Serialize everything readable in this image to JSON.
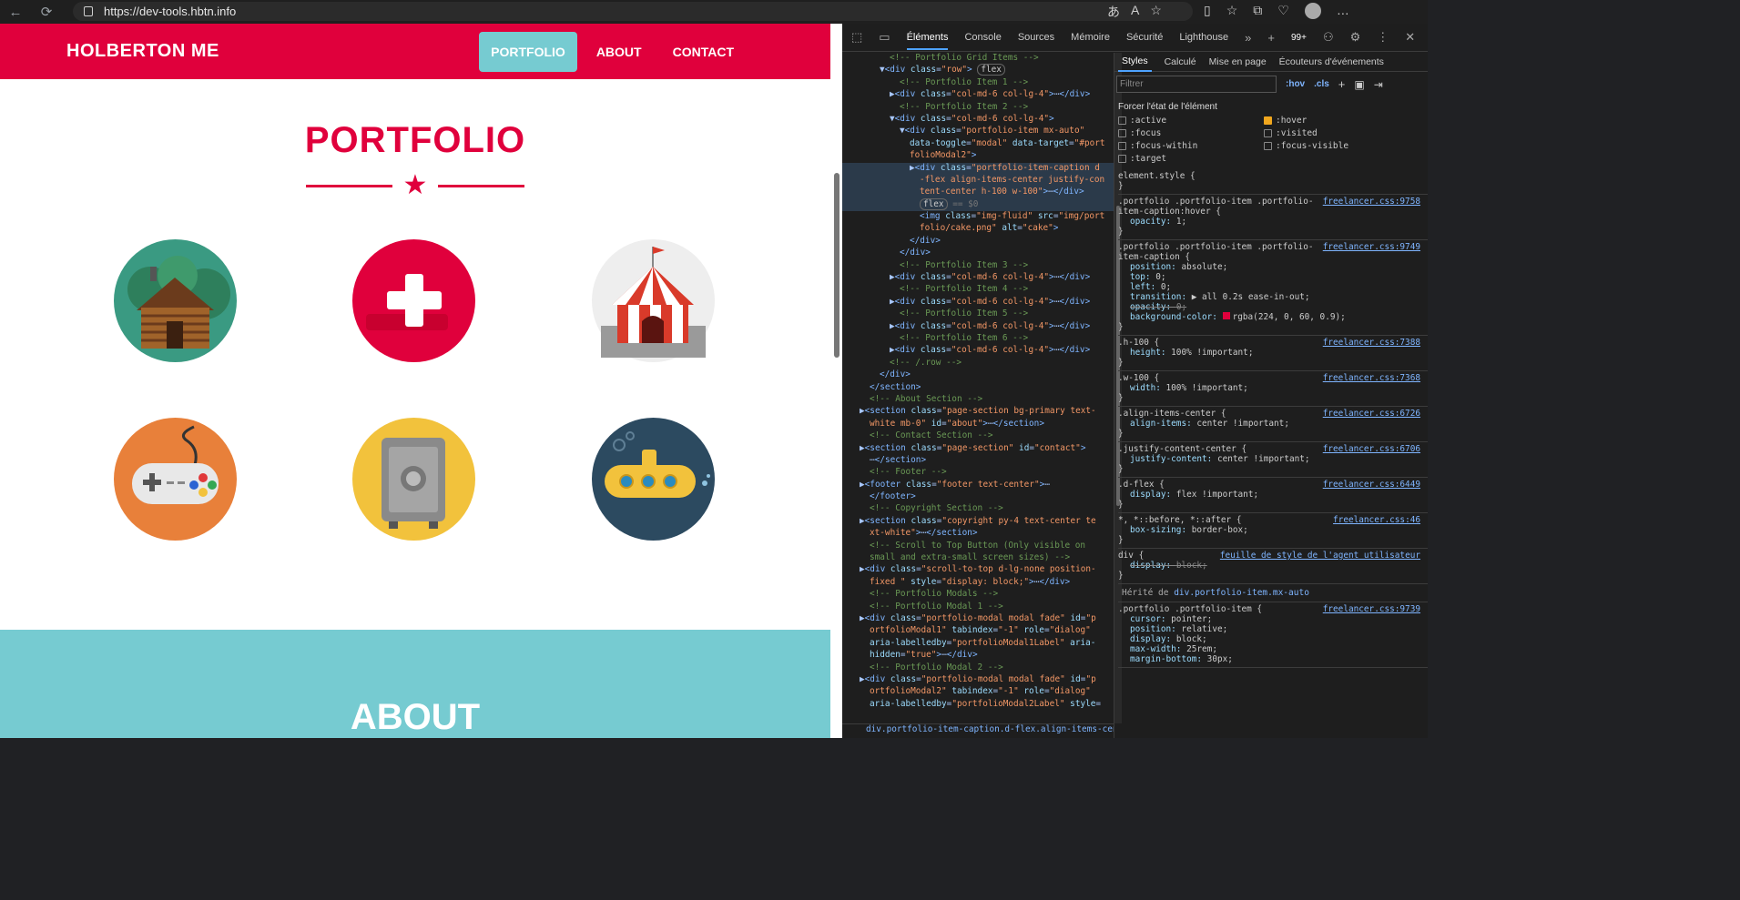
{
  "browser": {
    "url": "https://dev-tools.hbtn.info",
    "nav_back": "←",
    "nav_reload": "⟳",
    "url_icons": [
      "あ",
      "A",
      "☆"
    ],
    "toolbar_icons": [
      "▯",
      "☆",
      "⧉",
      "♡",
      "●",
      "…"
    ]
  },
  "site": {
    "brand": "HOLBERTON ME",
    "nav": [
      "PORTFOLIO",
      "ABOUT",
      "CONTACT"
    ],
    "portfolio_title": "PORTFOLIO",
    "about_title": "ABOUT",
    "colors": {
      "primary": "#e0003c",
      "secondary": "#76cbd1"
    },
    "tiles": [
      {
        "name": "cabin",
        "bg": "#bd4a67",
        "circle": "#3a9a82"
      },
      {
        "name": "cake",
        "bg": "#d71a4f",
        "circle": "#e0003c"
      },
      {
        "name": "circus",
        "bg": "#141414",
        "circle": "#eeeeee"
      },
      {
        "name": "game",
        "bg": "#1e7ec2",
        "circle": "#e8803a"
      },
      {
        "name": "safe",
        "bg": "#1034c0",
        "circle": "#f2c23c"
      },
      {
        "name": "submarine",
        "bg": "#d3b4a4",
        "circle": "#2c4a60"
      }
    ]
  },
  "devtools": {
    "tabs": [
      "Éléments",
      "Console",
      "Sources",
      "Mémoire",
      "Sécurité",
      "Lighthouse"
    ],
    "badge": "99+",
    "dom_lines": [
      {
        "indent": 4,
        "html": "<span class='cm'>&lt;!-- Portfolio Grid Items --&gt;</span>"
      },
      {
        "indent": 3,
        "html": "▼<span class='tg'>&lt;div</span> <span class='at'>class</span>=<span class='av'>\"row\"</span><span class='tg'>&gt;</span> <span style='border:1px solid #666;border-radius:6px;padding:0 3px;color:#ccc'>flex</span>"
      },
      {
        "indent": 5,
        "html": "<span class='cm'>&lt;!-- Portfolio Item 1 --&gt;</span>"
      },
      {
        "indent": 4,
        "html": "▶<span class='tg'>&lt;div</span> <span class='at'>class</span>=<span class='av'>\"col-md-6 col-lg-4\"</span><span class='tg'>&gt;</span>⋯<span class='tg'>&lt;/div&gt;</span>"
      },
      {
        "indent": 5,
        "html": "<span class='cm'>&lt;!-- Portfolio Item 2 --&gt;</span>"
      },
      {
        "indent": 4,
        "html": "▼<span class='tg'>&lt;div</span> <span class='at'>class</span>=<span class='av'>\"col-md-6 col-lg-4\"</span><span class='tg'>&gt;</span>"
      },
      {
        "indent": 5,
        "html": "▼<span class='tg'>&lt;div</span> <span class='at'>class</span>=<span class='av'>\"portfolio-item mx-auto\"</span>"
      },
      {
        "indent": 6,
        "html": "<span class='at'>data-toggle</span>=<span class='av'>\"modal\"</span> <span class='at'>data-target</span>=<span class='av'>\"#port</span>"
      },
      {
        "indent": 6,
        "html": "<span class='av'>folioModal2\"</span><span class='tg'>&gt;</span>"
      },
      {
        "indent": 6,
        "html": "▶<span class='tg'>&lt;div</span> <span class='at'>class</span>=<span class='av'>\"portfolio-item-caption d</span>",
        "sel": true
      },
      {
        "indent": 7,
        "html": "<span class='av'>-flex align-items-center justify-con</span>",
        "sel": true
      },
      {
        "indent": 7,
        "html": "<span class='av'>tent-center h-100 w-100\"</span><span class='tg'>&gt;</span>⋯<span class='tg'>&lt;/div&gt;</span>",
        "sel": true
      },
      {
        "indent": 7,
        "html": "<span style='border:1px solid #666;border-radius:6px;padding:0 3px;color:#ccc'>flex</span> <span style='color:#777'>== $0</span>",
        "sel": true
      },
      {
        "indent": 7,
        "html": "<span class='tg'>&lt;img</span> <span class='at'>class</span>=<span class='av'>\"img-fluid\"</span> <span class='at'>src</span>=<span class='av'>\"img/port</span>"
      },
      {
        "indent": 7,
        "html": "<span class='av'>folio/cake.png\"</span> <span class='at'>alt</span>=<span class='av'>\"cake\"</span><span class='tg'>&gt;</span>"
      },
      {
        "indent": 6,
        "html": "<span class='tg'>&lt;/div&gt;</span>"
      },
      {
        "indent": 5,
        "html": "<span class='tg'>&lt;/div&gt;</span>"
      },
      {
        "indent": 5,
        "html": "<span class='cm'>&lt;!-- Portfolio Item 3 --&gt;</span>"
      },
      {
        "indent": 4,
        "html": "▶<span class='tg'>&lt;div</span> <span class='at'>class</span>=<span class='av'>\"col-md-6 col-lg-4\"</span><span class='tg'>&gt;</span>⋯<span class='tg'>&lt;/div&gt;</span>"
      },
      {
        "indent": 5,
        "html": "<span class='cm'>&lt;!-- Portfolio Item 4 --&gt;</span>"
      },
      {
        "indent": 4,
        "html": "▶<span class='tg'>&lt;div</span> <span class='at'>class</span>=<span class='av'>\"col-md-6 col-lg-4\"</span><span class='tg'>&gt;</span>⋯<span class='tg'>&lt;/div&gt;</span>"
      },
      {
        "indent": 5,
        "html": "<span class='cm'>&lt;!-- Portfolio Item 5 --&gt;</span>"
      },
      {
        "indent": 4,
        "html": "▶<span class='tg'>&lt;div</span> <span class='at'>class</span>=<span class='av'>\"col-md-6 col-lg-4\"</span><span class='tg'>&gt;</span>⋯<span class='tg'>&lt;/div&gt;</span>"
      },
      {
        "indent": 5,
        "html": "<span class='cm'>&lt;!-- Portfolio Item 6 --&gt;</span>"
      },
      {
        "indent": 4,
        "html": "▶<span class='tg'>&lt;div</span> <span class='at'>class</span>=<span class='av'>\"col-md-6 col-lg-4\"</span><span class='tg'>&gt;</span>⋯<span class='tg'>&lt;/div&gt;</span>"
      },
      {
        "indent": 4,
        "html": "<span class='cm'>&lt;!-- /.row --&gt;</span>"
      },
      {
        "indent": 3,
        "html": "<span class='tg'>&lt;/div&gt;</span>"
      },
      {
        "indent": 2,
        "html": "<span class='tg'>&lt;/section&gt;</span>"
      },
      {
        "indent": 2,
        "html": "<span class='cm'>&lt;!-- About Section --&gt;</span>"
      },
      {
        "indent": 1,
        "html": "▶<span class='tg'>&lt;section</span> <span class='at'>class</span>=<span class='av'>\"page-section bg-primary text-</span>"
      },
      {
        "indent": 2,
        "html": "<span class='av'>white mb-0\"</span> <span class='at'>id</span>=<span class='av'>\"about\"</span><span class='tg'>&gt;</span>⋯<span class='tg'>&lt;/section&gt;</span>"
      },
      {
        "indent": 2,
        "html": "<span class='cm'>&lt;!-- Contact Section --&gt;</span>"
      },
      {
        "indent": 1,
        "html": "▶<span class='tg'>&lt;section</span> <span class='at'>class</span>=<span class='av'>\"page-section\"</span> <span class='at'>id</span>=<span class='av'>\"contact\"</span><span class='tg'>&gt;</span>"
      },
      {
        "indent": 2,
        "html": "⋯<span class='tg'>&lt;/section&gt;</span>"
      },
      {
        "indent": 2,
        "html": "<span class='cm'>&lt;!-- Footer --&gt;</span>"
      },
      {
        "indent": 1,
        "html": "▶<span class='tg'>&lt;footer</span> <span class='at'>class</span>=<span class='av'>\"footer text-center\"</span><span class='tg'>&gt;</span>⋯"
      },
      {
        "indent": 2,
        "html": "<span class='tg'>&lt;/footer&gt;</span>"
      },
      {
        "indent": 2,
        "html": "<span class='cm'>&lt;!-- Copyright Section --&gt;</span>"
      },
      {
        "indent": 1,
        "html": "▶<span class='tg'>&lt;section</span> <span class='at'>class</span>=<span class='av'>\"copyright py-4 text-center te</span>"
      },
      {
        "indent": 2,
        "html": "<span class='av'>xt-white\"</span><span class='tg'>&gt;</span>⋯<span class='tg'>&lt;/section&gt;</span>"
      },
      {
        "indent": 2,
        "html": "<span class='cm'>&lt;!-- Scroll to Top Button (Only visible on</span>"
      },
      {
        "indent": 2,
        "html": "<span class='cm'>small and extra-small screen sizes) --&gt;</span>"
      },
      {
        "indent": 1,
        "html": "▶<span class='tg'>&lt;div</span> <span class='at'>class</span>=<span class='av'>\"scroll-to-top d-lg-none position-</span>"
      },
      {
        "indent": 2,
        "html": "<span class='av'>fixed \"</span> <span class='at'>style</span>=<span class='av'>\"display: block;\"</span><span class='tg'>&gt;</span>⋯<span class='tg'>&lt;/div&gt;</span>"
      },
      {
        "indent": 2,
        "html": "<span class='cm'>&lt;!-- Portfolio Modals --&gt;</span>"
      },
      {
        "indent": 2,
        "html": "<span class='cm'>&lt;!-- Portfolio Modal 1 --&gt;</span>"
      },
      {
        "indent": 1,
        "html": "▶<span class='tg'>&lt;div</span> <span class='at'>class</span>=<span class='av'>\"portfolio-modal modal fade\"</span> <span class='at'>id</span>=<span class='av'>\"p</span>"
      },
      {
        "indent": 2,
        "html": "<span class='av'>ortfolioModal1\"</span> <span class='at'>tabindex</span>=<span class='av'>\"-1\"</span> <span class='at'>role</span>=<span class='av'>\"dialog\"</span>"
      },
      {
        "indent": 2,
        "html": "<span class='at'>aria-labelledby</span>=<span class='av'>\"portfolioModal1Label\"</span> <span class='at'>aria-</span>"
      },
      {
        "indent": 2,
        "html": "<span class='at'>hidden</span>=<span class='av'>\"true\"</span><span class='tg'>&gt;</span>⋯<span class='tg'>&lt;/div&gt;</span>"
      },
      {
        "indent": 2,
        "html": "<span class='cm'>&lt;!-- Portfolio Modal 2 --&gt;</span>"
      },
      {
        "indent": 1,
        "html": "▶<span class='tg'>&lt;div</span> <span class='at'>class</span>=<span class='av'>\"portfolio-modal modal fade\"</span> <span class='at'>id</span>=<span class='av'>\"p</span>"
      },
      {
        "indent": 2,
        "html": "<span class='av'>ortfolioModal2\"</span> <span class='at'>tabindex</span>=<span class='av'>\"-1\"</span> <span class='at'>role</span>=<span class='av'>\"dialog\"</span>"
      },
      {
        "indent": 2,
        "html": "<span class='at'>aria-labelledby</span>=<span class='av'>\"portfolioModal2Label\"</span> <span class='at'>style</span>="
      }
    ],
    "breadcrumb": "div.portfolio-item-caption.d-flex.align-items-center.justify-",
    "style_tabs": [
      "Styles",
      "Calculé",
      "Mise en page",
      "Écouteurs d'événements"
    ],
    "filter_placeholder": "Filtrer",
    "hov": ":hov",
    "cls": ".cls",
    "force_title": "Forcer l'état de l'élément",
    "states": [
      {
        "label": ":active",
        "on": false
      },
      {
        "label": ":hover",
        "on": true
      },
      {
        "label": ":focus",
        "on": false
      },
      {
        "label": ":visited",
        "on": false
      },
      {
        "label": ":focus-within",
        "on": false
      },
      {
        "label": ":focus-visible",
        "on": false
      },
      {
        "label": ":target",
        "on": false
      }
    ],
    "rules": [
      {
        "selector": "element.style {",
        "src": "",
        "props": [],
        "close": "}"
      },
      {
        "selector": ".portfolio .portfolio-item .portfolio-item-caption:hover {",
        "src": "freelancer.css:9758",
        "props": [
          {
            "n": "opacity",
            "v": "1;"
          }
        ],
        "close": "}"
      },
      {
        "selector": ".portfolio .portfolio-item .portfolio-item-caption {",
        "src": "freelancer.css:9749",
        "props": [
          {
            "n": "position",
            "v": "absolute;"
          },
          {
            "n": "top",
            "v": "0;"
          },
          {
            "n": "left",
            "v": "0;"
          },
          {
            "n": "transition",
            "v": "▶ all 0.2s ease-in-out;"
          },
          {
            "n": "opacity",
            "v": "0;",
            "strike": true
          },
          {
            "n": "background-color",
            "v": "rgba(224, 0, 60, 0.9);",
            "swatch": "#e0003c"
          }
        ],
        "close": "}"
      },
      {
        "selector": ".h-100 {",
        "src": "freelancer.css:7388",
        "props": [
          {
            "n": "height",
            "v": "100% !important;"
          }
        ],
        "close": "}"
      },
      {
        "selector": ".w-100 {",
        "src": "freelancer.css:7368",
        "props": [
          {
            "n": "width",
            "v": "100% !important;"
          }
        ],
        "close": "}"
      },
      {
        "selector": ".align-items-center {",
        "src": "freelancer.css:6726",
        "props": [
          {
            "n": "align-items",
            "v": "center !important;"
          }
        ],
        "close": "}"
      },
      {
        "selector": ".justify-content-center {",
        "src": "freelancer.css:6706",
        "props": [
          {
            "n": "justify-content",
            "v": "center !important;"
          }
        ],
        "close": "}"
      },
      {
        "selector": ".d-flex {",
        "src": "freelancer.css:6449",
        "props": [
          {
            "n": "display",
            "v": "flex !important;"
          }
        ],
        "close": "}"
      },
      {
        "selector": "*, *::before, *::after {",
        "src": "freelancer.css:46",
        "props": [
          {
            "n": "box-sizing",
            "v": "border-box;"
          }
        ],
        "close": "}"
      },
      {
        "selector": "div {",
        "src": "feuille de style de l'agent utilisateur",
        "props": [
          {
            "n": "display",
            "v": "block;",
            "strike": true
          }
        ],
        "close": "}"
      }
    ],
    "inherited_label": "Hérité de",
    "inherited_link": "div.portfolio-item.mx-auto",
    "last_rule": {
      "selector": ".portfolio .portfolio-item {",
      "src": "freelancer.css:9739",
      "props": [
        {
          "n": "cursor",
          "v": "pointer;"
        },
        {
          "n": "position",
          "v": "relative;"
        },
        {
          "n": "display",
          "v": "block;"
        },
        {
          "n": "max-width",
          "v": "25rem;"
        },
        {
          "n": "margin-bottom",
          "v": "30px;"
        }
      ]
    }
  }
}
